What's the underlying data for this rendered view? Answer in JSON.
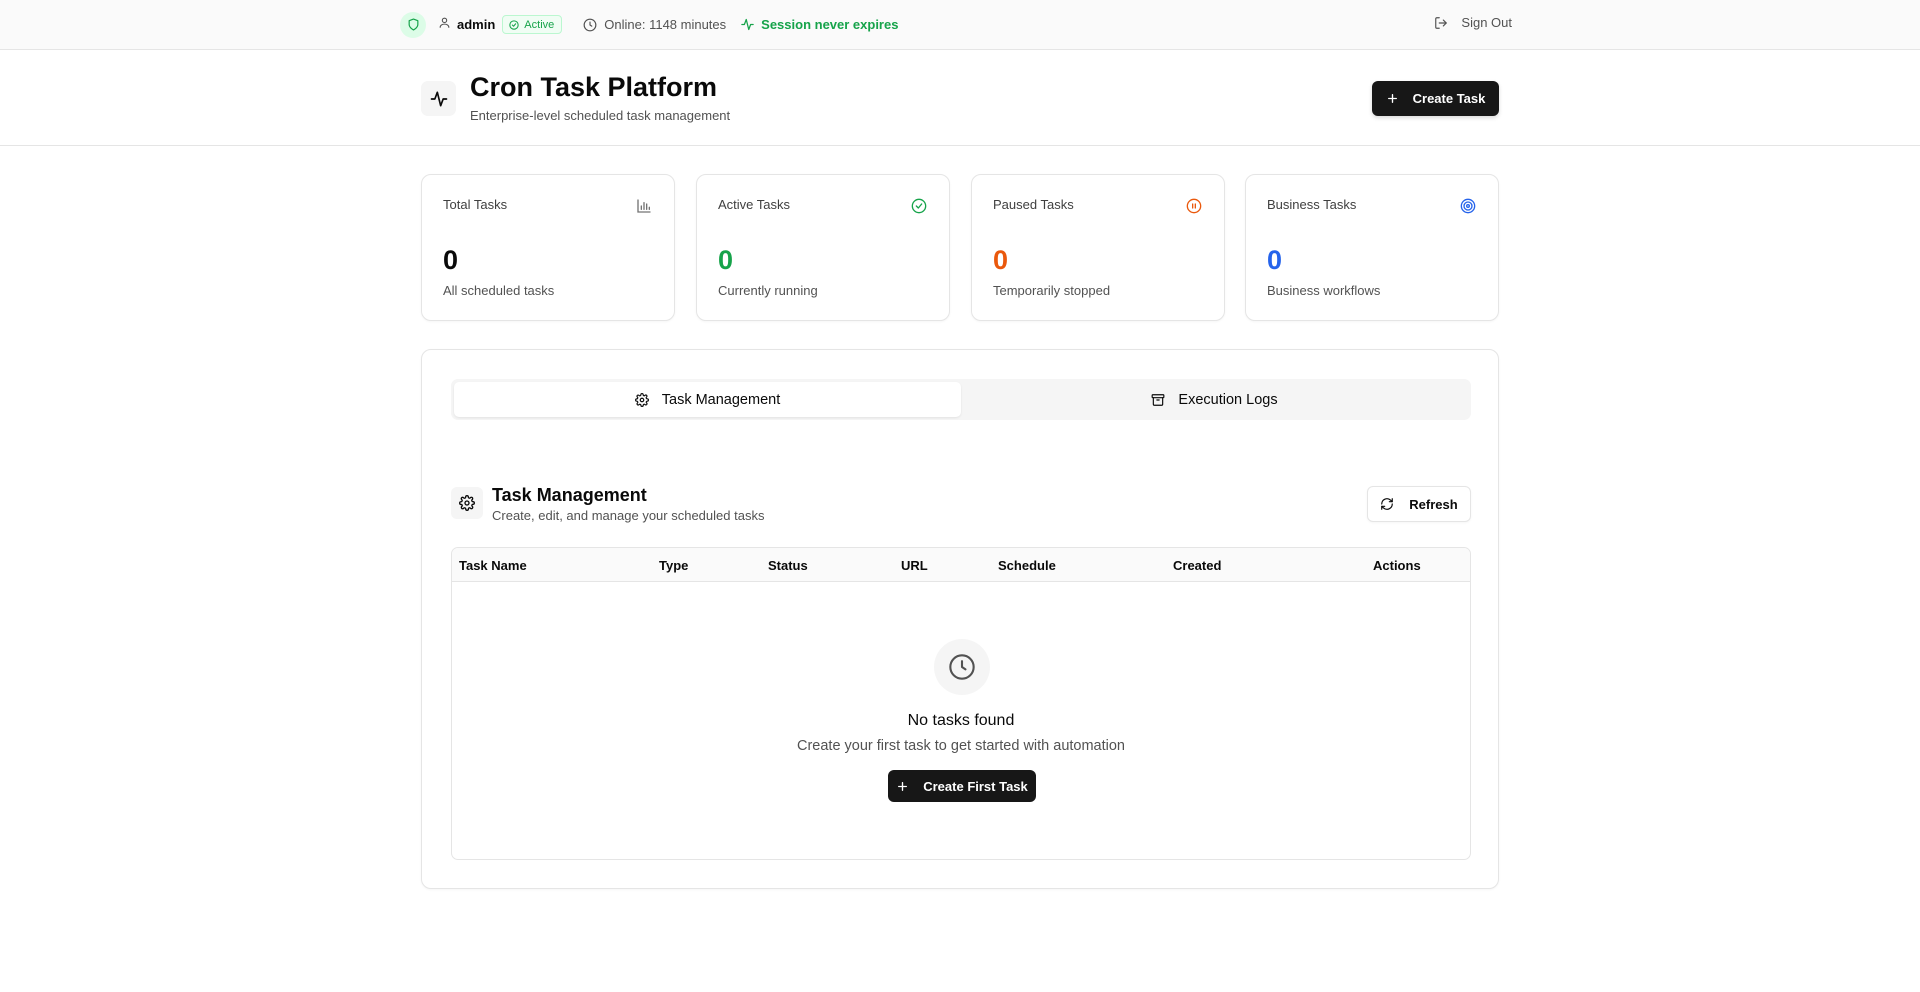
{
  "topbar": {
    "username": "admin",
    "status_badge": "Active",
    "online": "Online: 1148 minutes",
    "session": "Session never expires",
    "sign_out": "Sign Out"
  },
  "header": {
    "title": "Cron Task Platform",
    "subtitle": "Enterprise-level scheduled task management",
    "create_button": "Create Task"
  },
  "stats": [
    {
      "title": "Total Tasks",
      "value": "0",
      "desc": "All scheduled tasks",
      "color": "#0a0a0a",
      "icon": "bar-chart-icon"
    },
    {
      "title": "Active Tasks",
      "value": "0",
      "desc": "Currently running",
      "color": "#16a34a",
      "icon": "check-circle-icon"
    },
    {
      "title": "Paused Tasks",
      "value": "0",
      "desc": "Temporarily stopped",
      "color": "#ea580c",
      "icon": "pause-circle-icon"
    },
    {
      "title": "Business Tasks",
      "value": "0",
      "desc": "Business workflows",
      "color": "#2563eb",
      "icon": "target-icon"
    }
  ],
  "tabs": [
    {
      "label": "Task Management",
      "icon": "gear-icon",
      "active": true
    },
    {
      "label": "Execution Logs",
      "icon": "archive-icon",
      "active": false
    }
  ],
  "section": {
    "title": "Task Management",
    "subtitle": "Create, edit, and manage your scheduled tasks",
    "refresh": "Refresh"
  },
  "table": {
    "columns": [
      "Task Name",
      "Type",
      "Status",
      "URL",
      "Schedule",
      "Created",
      "Actions"
    ],
    "rows": []
  },
  "empty": {
    "title": "No tasks found",
    "subtitle": "Create your first task to get started with automation",
    "button": "Create First Task"
  }
}
